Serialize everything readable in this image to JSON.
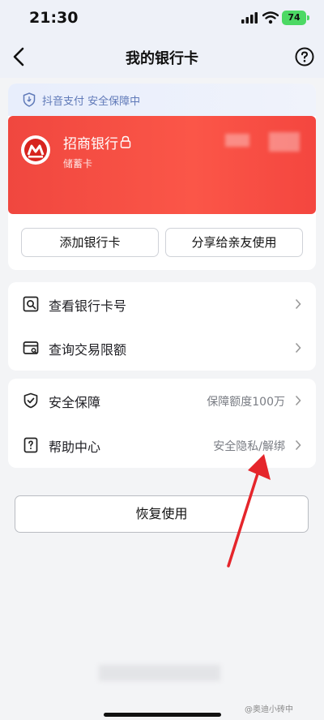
{
  "status_bar": {
    "time": "21:30",
    "battery": "74"
  },
  "nav": {
    "title": "我的银行卡"
  },
  "safe_banner": {
    "text": "抖音支付 安全保障中"
  },
  "card": {
    "bank_name": "招商银行",
    "card_type": "储蓄卡"
  },
  "actions": {
    "add_card": "添加银行卡",
    "share": "分享给亲友使用"
  },
  "menu_group_1": [
    {
      "label": "查看银行卡号",
      "icon": "search-card-icon"
    },
    {
      "label": "查询交易限额",
      "icon": "card-query-icon"
    }
  ],
  "menu_group_2": [
    {
      "label": "安全保障",
      "value": "保障额度100万",
      "icon": "shield-check-icon"
    },
    {
      "label": "帮助中心",
      "value": "安全隐私/解绑",
      "icon": "help-doc-icon"
    }
  ],
  "restore": {
    "label": "恢复使用"
  },
  "watermark": "@奥迪小砖中",
  "colors": {
    "card_red": "#f84f44",
    "safe_blue": "#5f79b8",
    "arrow_red": "#e5252b"
  }
}
